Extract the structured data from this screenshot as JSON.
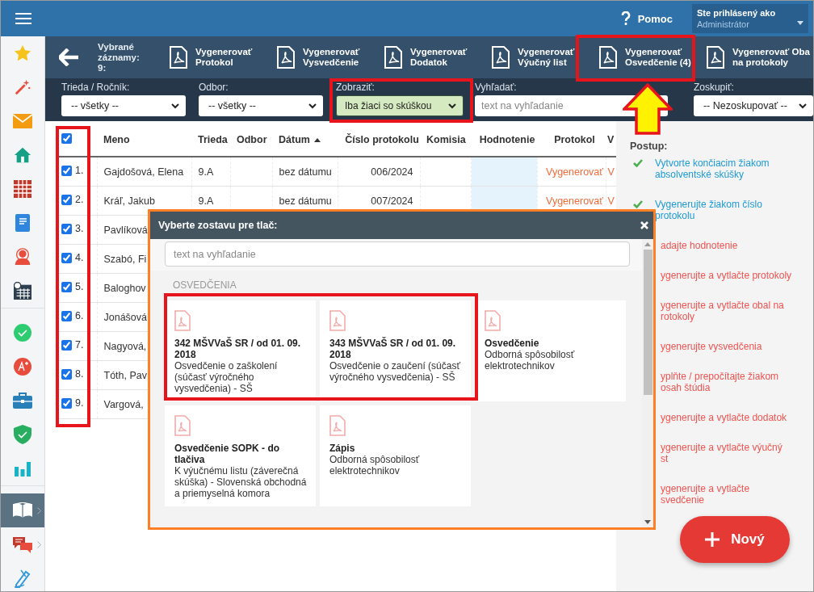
{
  "top_bar": {
    "help": "Pomoc",
    "user_label": "Ste prihlásený ako",
    "user_name": "Administrátor"
  },
  "sidebar": {
    "groups": [
      [
        {
          "selected": false,
          "submenu": false
        },
        {
          "selected": false,
          "submenu": false
        },
        {
          "selected": false,
          "submenu": false
        },
        {
          "selected": false,
          "submenu": false
        },
        {
          "selected": false,
          "submenu": false
        },
        {
          "selected": false,
          "submenu": false
        },
        {
          "selected": false,
          "submenu": false
        },
        {
          "selected": false,
          "submenu": false
        }
      ],
      [
        {
          "selected": false,
          "submenu": false
        },
        {
          "selected": false,
          "submenu": false
        },
        {
          "selected": false,
          "submenu": false
        },
        {
          "selected": false,
          "submenu": false
        },
        {
          "selected": false,
          "submenu": false
        }
      ],
      [
        {
          "selected": true,
          "submenu": true
        },
        {
          "selected": false,
          "submenu": true
        },
        {
          "selected": false,
          "submenu": false
        }
      ]
    ]
  },
  "toolbar": {
    "selection": "Vybrané záznamy: 9:",
    "actions": [
      {
        "line1": "Vygenerovať",
        "line2": "Protokol"
      },
      {
        "line1": "Vygenerovať",
        "line2": "Vysvedčenie"
      },
      {
        "line1": "Vygenerovať",
        "line2": "Dodatok"
      },
      {
        "line1": "Vygenerovať",
        "line2": "Výučný list"
      },
      {
        "line1": "Vygenerovať",
        "line2": "Osvedčenie (4)"
      },
      {
        "line1": "Vygenerovať Oba",
        "line2": "na protokoly"
      }
    ]
  },
  "filters": [
    {
      "kind": "select",
      "label": "Trieda / Ročník:",
      "value": "-- všetky --",
      "active": false
    },
    {
      "kind": "select",
      "label": "Odbor:",
      "value": "-- všetky --",
      "active": false
    },
    {
      "kind": "select",
      "label": "Zobraziť:",
      "value": "Iba žiaci so skúškou",
      "active": true
    },
    {
      "kind": "input",
      "label": "Vyhľadať:",
      "placeholder": "text na vyhľadanie"
    },
    {
      "kind": "select",
      "label": "Zoskupiť:",
      "value": "-- Nezoskupovať --",
      "active": false
    }
  ],
  "table": {
    "select_all_checked": true,
    "columns": [
      {
        "label": "Meno",
        "sorted": false
      },
      {
        "label": "Trieda",
        "sorted": false
      },
      {
        "label": "Odbor",
        "sorted": false
      },
      {
        "label": "Dátum",
        "sorted": true
      },
      {
        "label": "Číslo protokolu",
        "sorted": false
      },
      {
        "label": "Komisia",
        "sorted": false
      },
      {
        "label": "Hodnotenie",
        "sorted": false
      },
      {
        "label": "Protokol",
        "sorted": false
      },
      {
        "label": "V",
        "sorted": false
      }
    ],
    "rows": [
      {
        "checked": true,
        "number": "1.",
        "name": "Gajdošová, Elena",
        "class": "9.A",
        "date": "bez dátumu",
        "protocol_no": "006/2024",
        "protocol": "Vygenerovať",
        "column_9": "V"
      },
      {
        "checked": true,
        "number": "2.",
        "name": "Kráľ, Jakub",
        "class": "9.A",
        "date": "bez dátumu",
        "protocol_no": "007/2024",
        "protocol": "Vygenerovať",
        "column_9": "V"
      },
      {
        "checked": true,
        "number": "3.",
        "name": "Pavlíková"
      },
      {
        "checked": true,
        "number": "4.",
        "name": "Szabó, Fi"
      },
      {
        "checked": true,
        "number": "5.",
        "name": "Baloghov"
      },
      {
        "checked": true,
        "number": "6.",
        "name": "Jonášová"
      },
      {
        "checked": true,
        "number": "7.",
        "name": "Nagyová,"
      },
      {
        "checked": true,
        "number": "8.",
        "name": "Tóth, Pav"
      },
      {
        "checked": true,
        "number": "9.",
        "name": "Vargová,"
      }
    ]
  },
  "procedure": {
    "title": "Postup:",
    "steps": [
      {
        "text": "Vytvorte končiacim žiakom absolventské skúšky",
        "done": true
      },
      {
        "text": "Vygenerujte žiakom číslo protokolu",
        "done": true
      },
      {
        "text": "adajte hodnotenie",
        "done": false
      },
      {
        "text": "ygenerujte a vytlačte protokoly",
        "done": false
      },
      {
        "text": "ygenerujte a vytlačte obal na\nrotokoly",
        "done": false
      },
      {
        "text": "ygenerujte vysvedčenia",
        "done": false
      },
      {
        "text": "yplňte / prepočítajte žiakom\nosah štúdia",
        "done": false
      },
      {
        "text": "ygenerujte a vytlačte dodatok",
        "done": false
      },
      {
        "text": "ygenerujte a vytlačte výučný\nst",
        "done": false
      },
      {
        "text": "ygenerujte a vytlačte\nsvedčenie",
        "done": false
      }
    ]
  },
  "new_button": {
    "label": "Nový"
  },
  "dialog": {
    "title": "Vyberte zostavu pre tlač:",
    "search_placeholder": "text na vyhľadanie",
    "section": "OSVEDČENIA",
    "reports": [
      {
        "title": "342 MŠVVaŠ SR / od 01. 09. 2018",
        "description": "Osvedčenie o zaškolení (súčasť výročného vysvedčenia) - SŠ"
      },
      {
        "title": "343 MŠVVaŠ SR / od 01. 09. 2018",
        "description": "Osvedčenie o zaučení (súčasť výročného vysvedčenia) - SŠ"
      },
      {
        "title": "Osvedčenie",
        "description": "Odborná spôsobilosť elektrotechnikov"
      },
      {
        "title": "Osvedčenie SOPK - do tlačiva",
        "description": "K výučnému listu (záverečná skúška) - Slovenská obchodná a priemyselná komora"
      },
      {
        "title": "Zápis",
        "description": "Odborná spôsobilosť elektrotechnikov"
      }
    ]
  }
}
